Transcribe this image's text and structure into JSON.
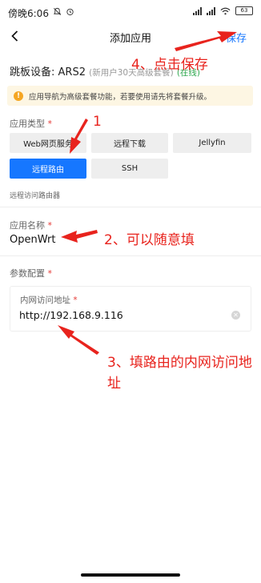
{
  "status_bar": {
    "time": "傍晚6:06",
    "battery": "63",
    "icons": [
      "bell-off-icon",
      "alarm-icon",
      "signal-icon",
      "signal-icon",
      "wifi-icon",
      "battery-icon"
    ]
  },
  "nav": {
    "title": "添加应用",
    "save_label": "保存",
    "back_icon": "chevron-left-icon"
  },
  "device": {
    "label": "跳板设备: ARS2",
    "subtitle": "(新用户30天高级套餐)",
    "status": "(在线)"
  },
  "notice": {
    "icon": "warning-icon",
    "text": "应用导航为高级套餐功能，若要使用请先将套餐升级。"
  },
  "app_type": {
    "label": "应用类型",
    "required_mark": "*",
    "options": [
      "Web网页服务",
      "远程下载",
      "Jellyfin",
      "远程路由",
      "SSH"
    ],
    "selected": "远程路由",
    "hint": "远程访问路由器"
  },
  "app_name": {
    "label": "应用名称",
    "required_mark": "*",
    "value": "OpenWrt"
  },
  "params": {
    "label": "参数配置",
    "required_mark": "*",
    "lan_address_label": "内网访问地址",
    "required_mark_inner": "*",
    "lan_address_value": "http://192.168.9.116"
  },
  "annotations": {
    "step1": "1",
    "step2": "2、可以随意填",
    "step3": "3、填路由的内网访问地址",
    "step4": "4、点击保存"
  },
  "colors": {
    "accent": "#1677ff",
    "annotation": "#e8231d",
    "online": "#2fa84f",
    "notice_bg": "#fdf6e3",
    "required": "#e53935"
  }
}
